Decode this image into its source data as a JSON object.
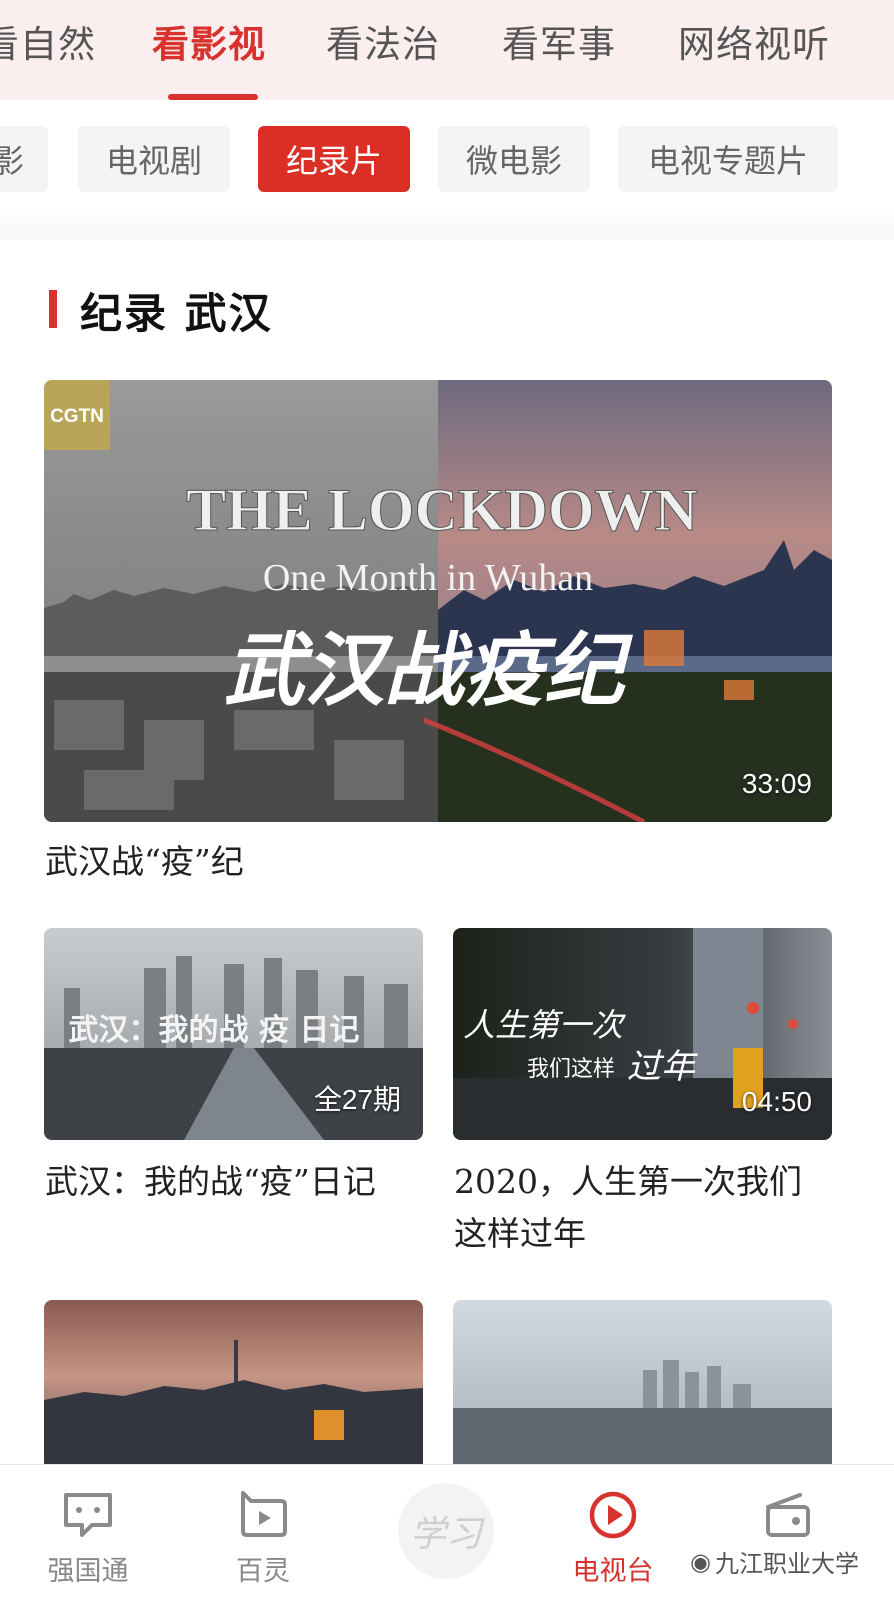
{
  "top_tabs": [
    "看自然",
    "看影视",
    "看法治",
    "看军事",
    "网络视听"
  ],
  "top_tab_active": "看影视",
  "sub_tabs": [
    "电影",
    "电视剧",
    "纪录片",
    "微电影",
    "电视专题片"
  ],
  "sub_tab_active": "纪录片",
  "section": {
    "title": "纪录 武汉"
  },
  "featured": {
    "logo": "CGTN",
    "overlay_title": "THE LOCKDOWN",
    "overlay_subtitle": "One Month in Wuhan",
    "overlay_cn": "武汉战疫纪",
    "duration": "33:09",
    "caption": "武汉战“疫”纪"
  },
  "grid": [
    {
      "overlay": "武汉：我的战 疫 日记",
      "badge": "全27期",
      "caption": "武汉：我的战“疫”日记"
    },
    {
      "overlay_line1": "人生第一次",
      "overlay_line2a": "我们这样",
      "overlay_line2b": "过年",
      "badge": "04:50",
      "caption": "2020，人生第一次我们这样过年"
    }
  ],
  "bottom_nav": [
    {
      "label": "强国通",
      "icon": "chat-icon"
    },
    {
      "label": "百灵",
      "icon": "play-square-icon"
    },
    {
      "label": "学习",
      "icon": "study-logo"
    },
    {
      "label": "电视台",
      "icon": "play-circle-icon",
      "active": true
    },
    {
      "label": "",
      "icon": "radio-icon"
    }
  ],
  "watermark": "九江职业大学",
  "colors": {
    "accent": "#d8322e",
    "top_bg": "#fbeeee"
  }
}
